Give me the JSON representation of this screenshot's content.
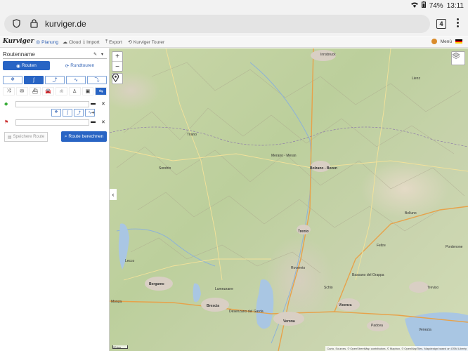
{
  "status_bar": {
    "wifi_icon": "wifi-icon",
    "battery_text": "74%",
    "time": "13:11"
  },
  "browser": {
    "url": "kurviger.de",
    "tab_count": "4"
  },
  "app_nav": {
    "logo": "Kurviger",
    "items": [
      {
        "label": "Planung",
        "icon": "◎"
      },
      {
        "label": "Cloud",
        "icon": "☁"
      },
      {
        "label": "Import",
        "icon": "⤓"
      },
      {
        "label": "Export",
        "icon": "⤒"
      },
      {
        "label": "Kurviger Tourer",
        "icon": "⟲"
      }
    ],
    "menu_label": "Menü"
  },
  "sidebar": {
    "route_name": "Routenname",
    "tab_route": "Routen",
    "tab_roundtrip": "Rundtouren",
    "btn_save": "Speichere Route",
    "btn_calc": "Route berechnen"
  },
  "map": {
    "labels": [
      {
        "t": "Innsbruck"
      },
      {
        "t": "Bolzano - Bozen"
      },
      {
        "t": "Trento"
      },
      {
        "t": "Lecco"
      },
      {
        "t": "Bergamo"
      },
      {
        "t": "Brescia"
      },
      {
        "t": "Vicenza"
      },
      {
        "t": "Verona"
      },
      {
        "t": "Padova"
      },
      {
        "t": "Treviso"
      },
      {
        "t": "Monza"
      },
      {
        "t": "Pordenone"
      },
      {
        "t": "Venezia"
      },
      {
        "t": "Merano - Meran"
      },
      {
        "t": "Lienz"
      },
      {
        "t": "Belluno"
      },
      {
        "t": "Rovereto"
      },
      {
        "t": "Sondrio"
      },
      {
        "t": "Tirano"
      },
      {
        "t": "Bassano del Grappa"
      },
      {
        "t": "Feltre"
      },
      {
        "t": "Schio"
      },
      {
        "t": "Lumezzane"
      },
      {
        "t": "Desenzano del Garda"
      }
    ],
    "scale": "20 km",
    "attribution": "Carto, Sources, © OpenStreetMap contributors, © Mapbox, © OpenMapTiles, Mapdesign based on OSM Liberty"
  },
  "colors": {
    "accent": "#2864c4",
    "map_green": "#c4d3a2"
  }
}
